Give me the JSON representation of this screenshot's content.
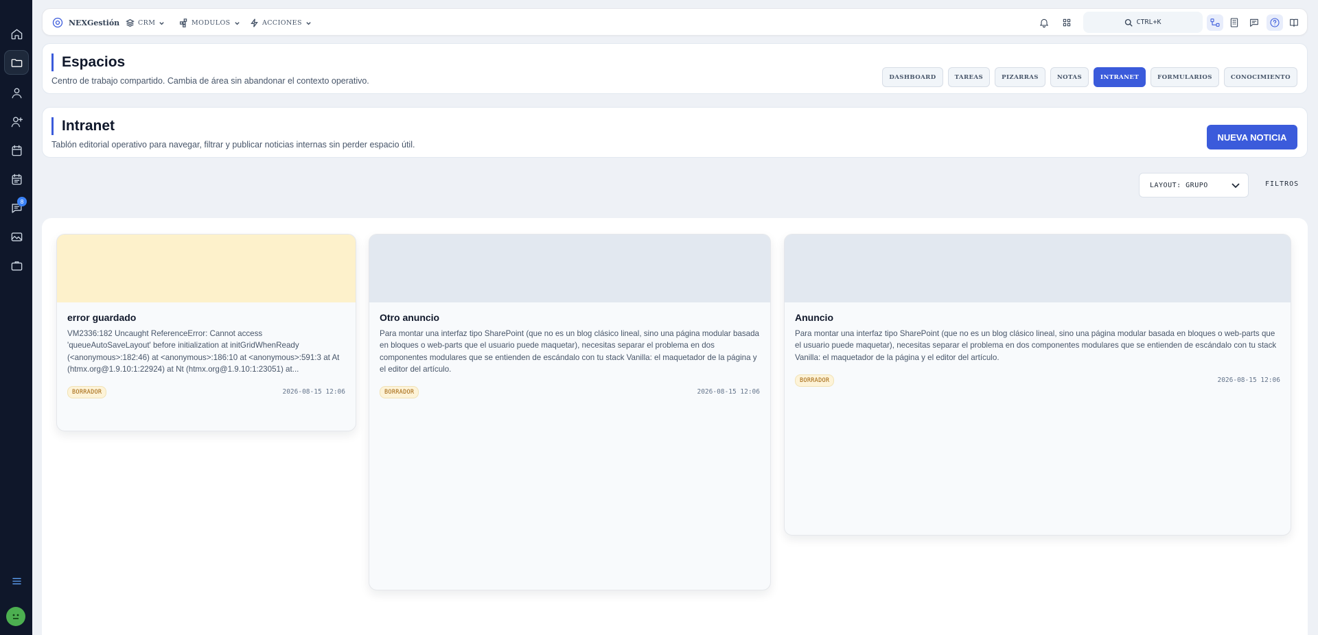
{
  "topbar": {
    "brand": "NEXGestión",
    "menus": [
      "CRM",
      "MODULOS",
      "ACCIONES"
    ],
    "search_label": "CTRL+K",
    "icons": [
      "bell-icon",
      "grid-icon",
      "hierarchy-icon",
      "building-icon",
      "chat-icon",
      "help-icon",
      "book-icon"
    ]
  },
  "sidebar": {
    "items": [
      "home-icon",
      "folder-icon",
      "user-icon",
      "user-plus-icon",
      "calendar-icon",
      "calendar-alt-icon",
      "messages-icon",
      "image-icon",
      "briefcase-icon",
      "menu-icon"
    ],
    "badge": "8"
  },
  "espacios": {
    "title": "Espacios",
    "subtitle": "Centro de trabajo compartido. Cambia de área sin abandonar el contexto operativo.",
    "tabs": [
      {
        "label": "DASHBOARD"
      },
      {
        "label": "TAREAS"
      },
      {
        "label": "PIZARRAS"
      },
      {
        "label": "NOTAS"
      },
      {
        "label": "INTRANET"
      },
      {
        "label": "FORMULARIOS"
      },
      {
        "label": "CONOCIMIENTO"
      }
    ],
    "active_tab": "INTRANET"
  },
  "intranet": {
    "title": "Intranet",
    "subtitle": "Tablón editorial operativo para navegar, filtrar y publicar noticias internas sin perder espacio útil.",
    "new_button": "NUEVA NOTICIA"
  },
  "controls": {
    "layout_label": "LAYOUT: GRUPO",
    "filters_label": "FILTROS"
  },
  "cards": [
    {
      "title": "error guardado",
      "body": "VM2336:182 Uncaught ReferenceError: Cannot access 'queueAutoSaveLayout' before initialization at initGridWhenReady (<anonymous>:182:46) at <anonymous>:186:10 at <anonymous>:591:3 at At (htmx.org@1.9.10:1:22924) at Nt (htmx.org@1.9.10:1:23051) at...",
      "status": "BORRADOR",
      "date": "2026-08-15 12:06",
      "cover_color": "#fdf1cb"
    },
    {
      "title": "Otro anuncio",
      "body": "Para montar una interfaz tipo SharePoint (que no es un blog clásico lineal, sino una página modular basada en bloques o web-parts que el usuario puede maquetar), necesitas separar el problema en dos componentes modulares que se entienden de escándalo con tu stack Vanilla: el maquetador de la página y el editor del artículo.",
      "status": "BORRADOR",
      "date": "2026-08-15 12:06",
      "cover_color": "#e2e8f0"
    },
    {
      "title": "Anuncio",
      "body": "Para montar una interfaz tipo SharePoint (que no es un blog clásico lineal, sino una página modular basada en bloques o web-parts que el usuario puede maquetar), necesitas separar el problema en dos componentes modulares que se entienden de escándalo con tu stack Vanilla: el maquetador de la página y el editor del artículo.",
      "status": "BORRADOR",
      "date": "2026-08-15 12:06",
      "cover_color": "#e2e8f0"
    }
  ],
  "colors": {
    "accent": "#3b5bdb",
    "sidebar": "#0f172a",
    "background": "#eef1f6"
  }
}
